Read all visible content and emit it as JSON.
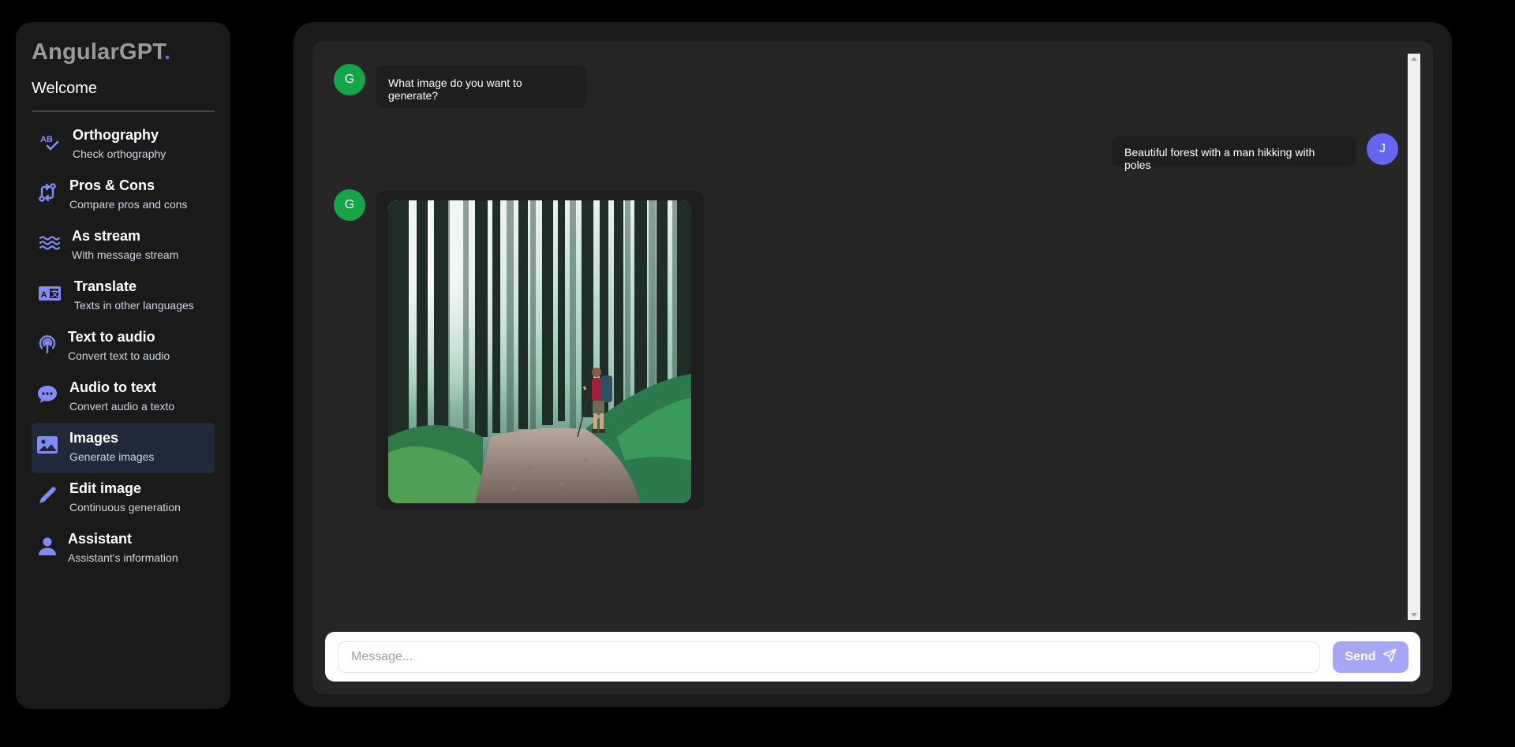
{
  "app": {
    "brand": "AngularGPT",
    "brand_dot": ".",
    "welcome": "Welcome"
  },
  "sidebar": {
    "items": [
      {
        "title": "Orthography",
        "subtitle": "Check orthography",
        "icon": "spell-check-icon"
      },
      {
        "title": "Pros & Cons",
        "subtitle": "Compare pros and cons",
        "icon": "compare-arrows-icon"
      },
      {
        "title": "As stream",
        "subtitle": "With message stream",
        "icon": "waves-icon"
      },
      {
        "title": "Translate",
        "subtitle": "Texts in other languages",
        "icon": "translate-icon"
      },
      {
        "title": "Text to audio",
        "subtitle": "Convert text to audio",
        "icon": "podcast-icon"
      },
      {
        "title": "Audio to text",
        "subtitle": "Convert audio a texto",
        "icon": "chat-bubble-icon"
      },
      {
        "title": "Images",
        "subtitle": "Generate images",
        "icon": "image-icon"
      },
      {
        "title": "Edit image",
        "subtitle": "Continuous generation",
        "icon": "pencil-icon"
      },
      {
        "title": "Assistant",
        "subtitle": "Assistant's information",
        "icon": "person-icon"
      }
    ],
    "active_index": 6
  },
  "chat": {
    "messages": [
      {
        "from": "bot",
        "avatar": "G",
        "text": "What image do you want to generate?"
      },
      {
        "from": "user",
        "avatar": "J",
        "text": "Beautiful forest with a man hikking with poles"
      },
      {
        "from": "bot",
        "avatar": "G",
        "image": "forest-hiker-image"
      }
    ]
  },
  "input": {
    "placeholder": "Message...",
    "value": "",
    "send_label": "Send"
  },
  "colors": {
    "accent": "#6366f1",
    "bot_avatar": "#16a34a",
    "send_disabled": "#a5a6f6"
  }
}
